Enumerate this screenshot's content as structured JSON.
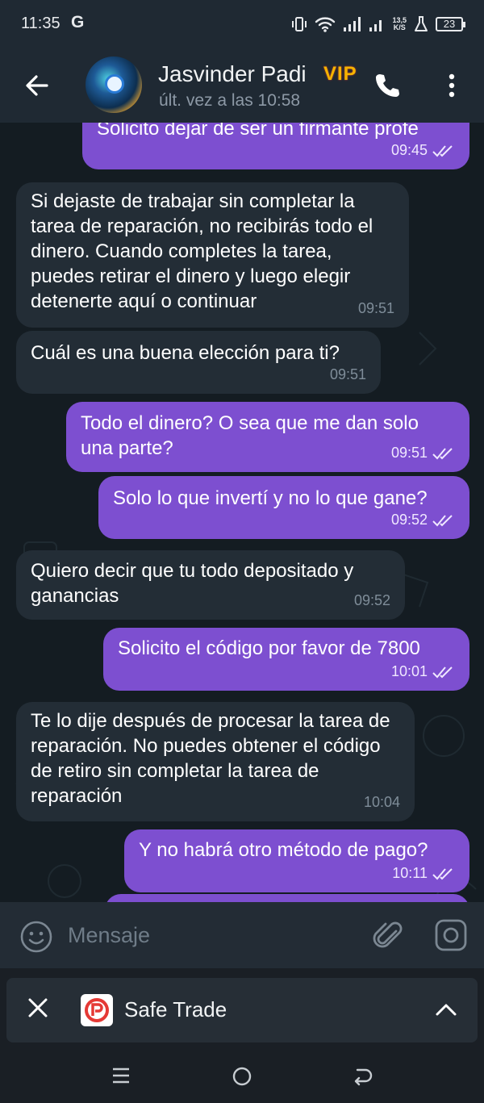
{
  "status_bar": {
    "time": "11:35",
    "g_label": "G",
    "net_speed_value": "13,5",
    "net_speed_unit": "K/S",
    "battery": "23"
  },
  "header": {
    "contact_name": "Jasvinder Padi",
    "badge": "VIP",
    "last_seen": "últ. vez a las 10:58"
  },
  "messages": [
    {
      "direction": "out",
      "text": "Solicito dejar de ser un firmante profe",
      "time": "09:45"
    },
    {
      "direction": "in",
      "text": "Si dejaste de trabajar sin completar la tarea de reparación, no recibirás todo el dinero. Cuando completes la tarea, puedes retirar el dinero y luego elegir detenerte aquí o continuar",
      "time": "09:51"
    },
    {
      "direction": "in",
      "text": "Cuál es una buena elección para ti?",
      "time": "09:51"
    },
    {
      "direction": "out",
      "text": "Todo el dinero? O sea que me dan solo una parte?",
      "time": "09:51"
    },
    {
      "direction": "out",
      "text": "Solo lo que invertí y no lo que gane?",
      "time": "09:52"
    },
    {
      "direction": "in",
      "text": "Quiero decir que tu todo depositado y ganancias",
      "time": "09:52"
    },
    {
      "direction": "out",
      "text": "Solicito el código por favor de 7800",
      "time": "10:01"
    },
    {
      "direction": "in",
      "text": "Te lo dije después de procesar la tarea de reparación. No puedes obtener el código de retiro sin completar la tarea de reparación",
      "time": "10:04"
    },
    {
      "direction": "out",
      "text": "Y no habrá otro método de pago?",
      "time": "10:11"
    }
  ],
  "input": {
    "placeholder": "Mensaje"
  },
  "app_panel": {
    "name": "Safe Trade"
  },
  "icons": {
    "back": "arrow-left-icon",
    "call": "phone-icon",
    "more": "more-vertical-icon",
    "emoji": "smiley-icon",
    "attach": "paperclip-icon",
    "camera": "camera-icon",
    "read": "double-check-icon"
  },
  "colors": {
    "outgoing_bubble": "#7d4fd0",
    "incoming_bubble": "#232d36",
    "vip_badge": "#f5b300",
    "chat_background": "#141c22"
  }
}
